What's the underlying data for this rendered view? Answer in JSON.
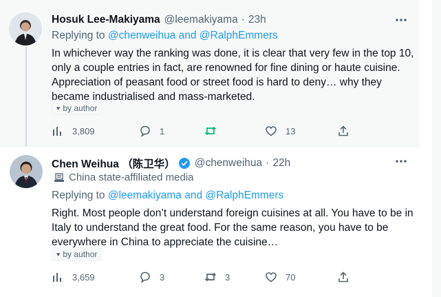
{
  "tweets": [
    {
      "name": "Hosuk Lee-Makiyama",
      "handle": "@leemakiyama",
      "separator": "·",
      "time": "23h",
      "reply_prefix": "Replying to",
      "reply_mentions": "@chenweihua and @RalphEmmers",
      "text": "In whichever way the ranking was done, it is clear that very few in the top 10, only a couple entries in fact, are renowned for fine dining or haute cuisine. Appreciation of peasant food or street food is hard to deny… why they became industrialised and mass-marketed.",
      "author_tag": "by author",
      "counts": {
        "views": "3,809",
        "replies": "1",
        "retweets": "",
        "likes": "13"
      }
    },
    {
      "name": "Chen Weihua （陈卫华）",
      "handle": "@chenweihua",
      "separator": "·",
      "time": "22h",
      "affiliation": "China state-affiliated media",
      "reply_prefix": "Replying to",
      "reply_mentions": "@leemakiyama and @RalphEmmers",
      "text": "Right. Most people don’t understand foreign cuisines at all.  You have to be in Italy to understand the great food.  For the same reason, you have to be everywhere in China to appreciate the cuisine…",
      "author_tag": "by author",
      "counts": {
        "views": "3,659",
        "replies": "3",
        "retweets": "3",
        "likes": "70"
      }
    }
  ],
  "icons": {
    "views": "bar-chart-icon",
    "reply": "speech-bubble-icon",
    "retweet": "retweet-arrows-icon",
    "like": "heart-icon",
    "share": "share-upload-icon",
    "more": "more-dots-icon",
    "verified": "verified-badge-icon",
    "affiliation": "state-media-flag-icon"
  },
  "colors": {
    "link": "#1d9bf0",
    "secondary_text": "#536471",
    "verified": "#1d9bf0",
    "retweet_active": "#00ba7c",
    "thread_line": "#cfd9de"
  }
}
